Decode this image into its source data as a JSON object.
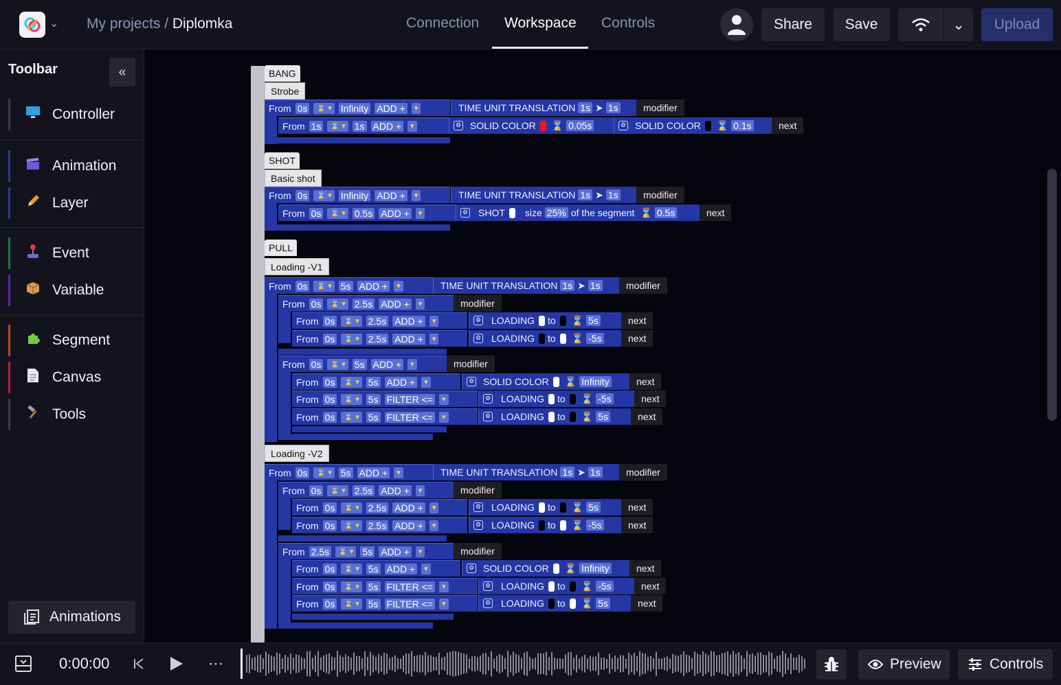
{
  "header": {
    "breadcrumb_root": "My projects",
    "breadcrumb_sep": "/",
    "project": "Diplomka",
    "tabs": [
      "Connection",
      "Workspace",
      "Controls"
    ],
    "active_tab": "Workspace",
    "share_label": "Share",
    "save_label": "Save",
    "upload_label": "Upload"
  },
  "sidebar": {
    "title": "Toolbar",
    "items": [
      {
        "label": "Controller",
        "icon": "monitor-icon",
        "color": "#4a90e2"
      },
      {
        "label": "Animation",
        "icon": "clapperboard-icon",
        "color": "#3a4a9a"
      },
      {
        "label": "Layer",
        "icon": "pencil-icon",
        "color": "#3a4a9a"
      },
      {
        "label": "Event",
        "icon": "joystick-icon",
        "color": "#1f8a3a"
      },
      {
        "label": "Variable",
        "icon": "package-icon",
        "color": "#6a2fc8"
      },
      {
        "label": "Segment",
        "icon": "puzzle-icon",
        "color": "#c8521f"
      },
      {
        "label": "Canvas",
        "icon": "document-icon",
        "color": "#c81f3a"
      },
      {
        "label": "Tools",
        "icon": "hammer-icon",
        "color": "#555566"
      }
    ],
    "animations_label": "Animations"
  },
  "player": {
    "time": "0:00:00",
    "preview_label": "Preview",
    "controls_label": "Controls"
  },
  "workspace": {
    "categories": [
      "BANG",
      "SHOT",
      "PULL"
    ],
    "animations": [
      "Strobe",
      "Basic shot",
      "Loading -V1",
      "Loading -V2"
    ],
    "words": {
      "from": "From",
      "add": "ADD +",
      "filter": "FILTER <=",
      "infinity": "Infinity",
      "ttu": "TIME UNIT TRANSLATION",
      "modifier": "modifier",
      "next": "next",
      "solid": "SOLID COLOR",
      "loading": "LOADING",
      "to": "to",
      "shot": "SHOT",
      "size": "size",
      "of_segment": "of the segment"
    }
  }
}
